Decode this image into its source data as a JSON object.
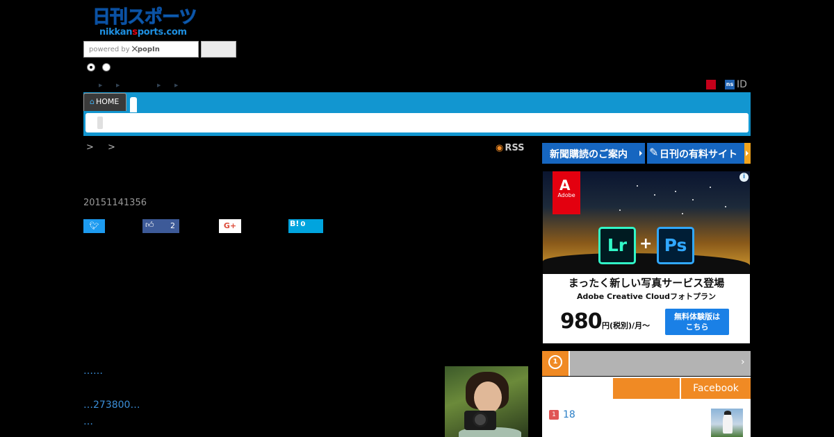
{
  "header": {
    "logo_jp": "日刊スポーツ",
    "logo_en_pre": "nikkan",
    "logo_en_mid": "s",
    "logo_en_post": "ports.com",
    "search_placeholder_prefix": "powered by",
    "search_placeholder_brand": "popIn",
    "user_badge": "ns",
    "user_id": "ID"
  },
  "nav": {
    "home_label": "HOME"
  },
  "article": {
    "breadcrumb": "> >",
    "rss_label": "RSS",
    "timestamp": "20151141356",
    "share": {
      "fb_count": "2",
      "gplus_label": "G+",
      "hatena_label": "B!",
      "hatena_count": "0"
    },
    "links": [
      "……",
      "…273800…",
      "…"
    ]
  },
  "sidebar": {
    "subscribe_label": "新聞購読のご案内",
    "paid_site_label": "日刊の有料サイト",
    "ad": {
      "brand": "Adobe",
      "app1": "Lr",
      "app2": "Ps",
      "plus": "+",
      "headline": "まったく新しい写真サービス登場",
      "subline": "Adobe Creative Cloudフォトプラン",
      "price": "980",
      "price_suffix": "円(税別)/月〜",
      "cta_line1": "無料体験版は",
      "cta_line2": "こちら",
      "info": "i"
    },
    "ranking": {
      "medal": "1",
      "tab_facebook": "Facebook",
      "item_rank": "1",
      "item_text": "18"
    }
  },
  "colors": {
    "nav_blue": "#1296d0",
    "link_blue": "#3b8fd9",
    "accent_orange": "#f08a24",
    "button_blue": "#1666c0"
  }
}
